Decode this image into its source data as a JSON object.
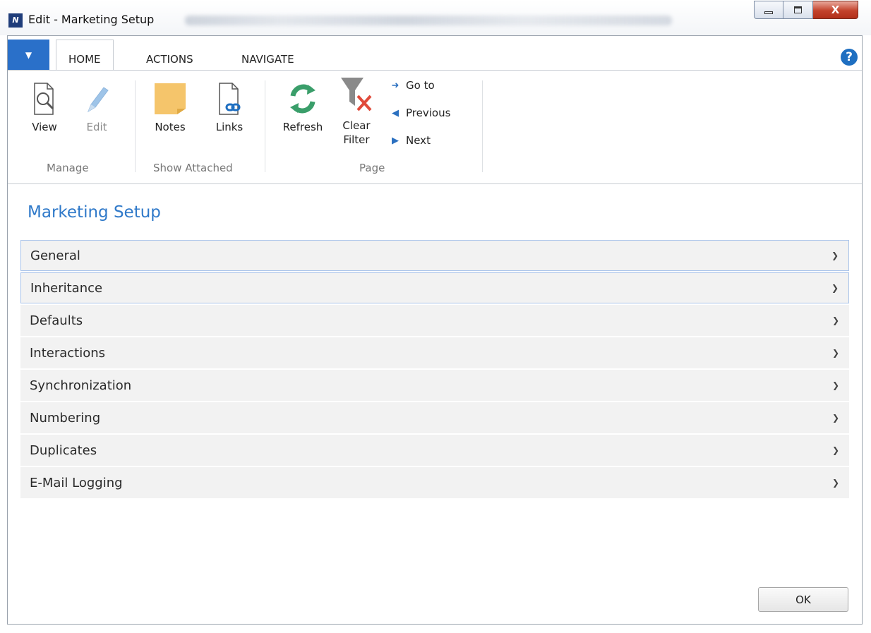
{
  "window": {
    "title": "Edit - Marketing Setup",
    "logo_text": "N",
    "close_label": "X"
  },
  "tabs": [
    {
      "label": "HOME"
    },
    {
      "label": "ACTIONS"
    },
    {
      "label": "NAVIGATE"
    }
  ],
  "help_glyph": "?",
  "ribbon": {
    "manage": {
      "group_label": "Manage",
      "view_label": "View",
      "edit_label": "Edit"
    },
    "show_attached": {
      "group_label": "Show Attached",
      "notes_label": "Notes",
      "links_label": "Links"
    },
    "page": {
      "group_label": "Page",
      "refresh_label": "Refresh",
      "clear_filter_line1": "Clear",
      "clear_filter_line2": "Filter",
      "goto_label": "Go to",
      "previous_label": "Previous",
      "next_label": "Next"
    }
  },
  "page_title": "Marketing Setup",
  "sections": [
    {
      "label": "General"
    },
    {
      "label": "Inheritance"
    },
    {
      "label": "Defaults"
    },
    {
      "label": "Interactions"
    },
    {
      "label": "Synchronization"
    },
    {
      "label": "Numbering"
    },
    {
      "label": "Duplicates"
    },
    {
      "label": "E-Mail Logging"
    }
  ],
  "ok_label": "OK",
  "icons": {
    "view": "view-magnifier-icon",
    "edit": "pencil-icon",
    "notes": "sticky-note-icon",
    "links": "document-link-icon",
    "refresh": "refresh-icon",
    "clear_filter": "funnel-clear-icon",
    "goto": "arrow-right-icon",
    "previous": "triangle-left-icon",
    "next": "triangle-right-icon",
    "expand": "chevron-down-icon"
  },
  "colors": {
    "accent": "#2f79c9",
    "app_menu": "#2a70c9",
    "notes_yellow": "#f5c56b",
    "refresh_green": "#3a9e6a",
    "clear_red": "#e04a3a"
  }
}
